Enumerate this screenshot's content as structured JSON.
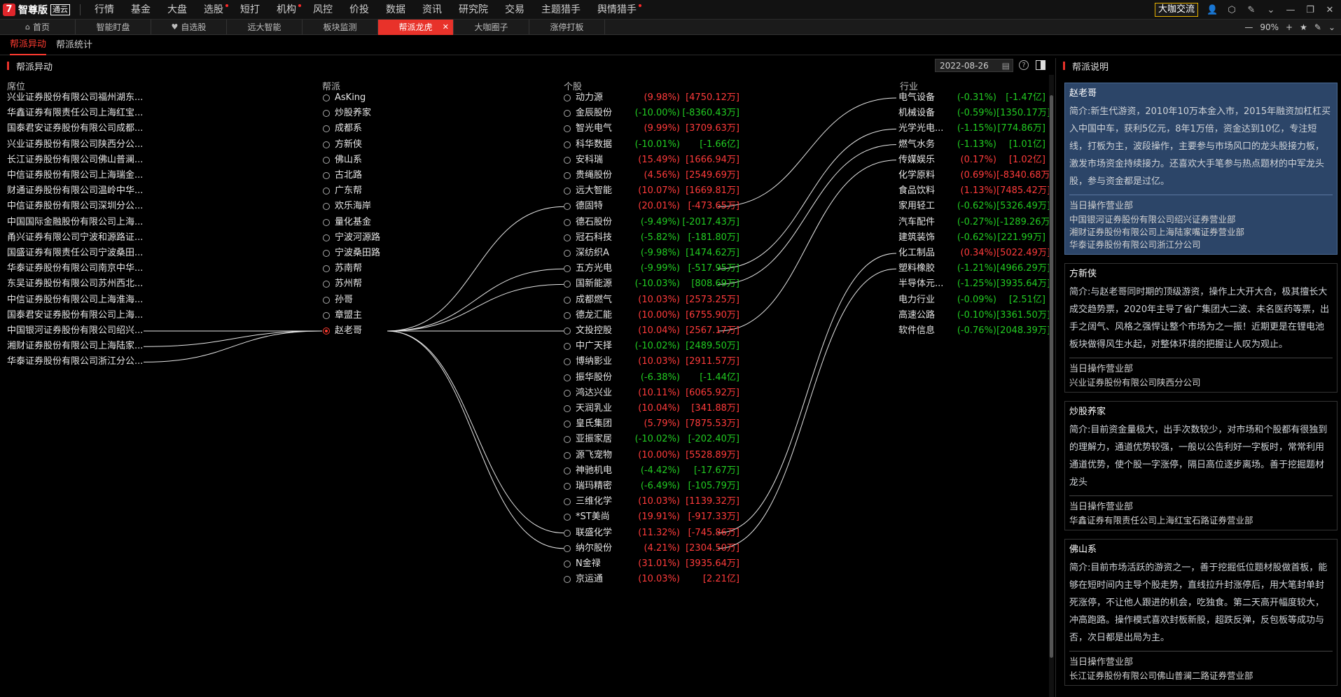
{
  "app": {
    "logo": "智尊版",
    "badge": "通云"
  },
  "menu": [
    {
      "label": "行情",
      "dot": false
    },
    {
      "label": "基金",
      "dot": false
    },
    {
      "label": "大盘",
      "dot": false
    },
    {
      "label": "选股",
      "dot": true
    },
    {
      "label": "短打",
      "dot": false
    },
    {
      "label": "机构",
      "dot": true
    },
    {
      "label": "风控",
      "dot": false
    },
    {
      "label": "价投",
      "dot": false
    },
    {
      "label": "数据",
      "dot": false
    },
    {
      "label": "资讯",
      "dot": false
    },
    {
      "label": "研究院",
      "dot": false
    },
    {
      "label": "交易",
      "dot": false
    },
    {
      "label": "主题猎手",
      "dot": false
    },
    {
      "label": "舆情猎手",
      "dot": true
    }
  ],
  "chat_button": "大咖交流",
  "tabs": [
    {
      "label": "首页",
      "icon": "⌂",
      "active": false
    },
    {
      "label": "智能盯盘",
      "icon": "",
      "active": false
    },
    {
      "label": "自选股",
      "icon": "♥",
      "active": false
    },
    {
      "label": "远大智能",
      "icon": "",
      "active": false
    },
    {
      "label": "板块监测",
      "icon": "",
      "active": false
    },
    {
      "label": "帮派龙虎",
      "icon": "",
      "active": true
    },
    {
      "label": "大咖圈子",
      "icon": "",
      "active": false
    },
    {
      "label": "涨停打板",
      "icon": "",
      "active": false
    }
  ],
  "zoom": "90%",
  "subtabs": [
    {
      "label": "帮派异动",
      "active": true
    },
    {
      "label": "帮派统计",
      "active": false
    }
  ],
  "section_title": "帮派异动",
  "date": "2022-08-26",
  "help_glyph": "?",
  "columns": {
    "seat": "席位",
    "gang": "帮派",
    "stock": "个股",
    "industry": "行业"
  },
  "seats": [
    "兴业证券股份有限公司福州湖东...",
    "华鑫证券有限责任公司上海红宝...",
    "国泰君安证券股份有限公司成都...",
    "兴业证券股份有限公司陕西分公...",
    "长江证券股份有限公司佛山普澜...",
    "中信证券股份有限公司上海瑞金...",
    "财通证券股份有限公司温岭中华...",
    "中信证券股份有限公司深圳分公...",
    "中国国际金融股份有限公司上海...",
    "甬兴证券有限公司宁波和源路证...",
    "国盛证券有限责任公司宁波桑田...",
    "华泰证券股份有限公司南京中华...",
    "东吴证券股份有限公司苏州西北...",
    "中信证券股份有限公司上海淮海...",
    "国泰君安证券股份有限公司上海...",
    "中国银河证券股份有限公司绍兴...",
    "湘财证券股份有限公司上海陆家...",
    "华泰证券股份有限公司浙江分公..."
  ],
  "gangs": [
    {
      "name": "AsKing",
      "selected": false
    },
    {
      "name": "炒股养家",
      "selected": false
    },
    {
      "name": "成都系",
      "selected": false
    },
    {
      "name": "方新侠",
      "selected": false
    },
    {
      "name": "佛山系",
      "selected": false
    },
    {
      "name": "古北路",
      "selected": false
    },
    {
      "name": "广东帮",
      "selected": false
    },
    {
      "name": "欢乐海岸",
      "selected": false
    },
    {
      "name": "量化基金",
      "selected": false
    },
    {
      "name": "宁波河源路",
      "selected": false
    },
    {
      "name": "宁波桑田路",
      "selected": false
    },
    {
      "name": "苏南帮",
      "selected": false
    },
    {
      "name": "苏州帮",
      "selected": false
    },
    {
      "name": "孙哥",
      "selected": false
    },
    {
      "name": "章盟主",
      "selected": false
    },
    {
      "name": "赵老哥",
      "selected": true
    }
  ],
  "stocks": [
    {
      "name": "动力源",
      "pct": "(9.98%)",
      "amt": "[4750.12万]",
      "dir": "up"
    },
    {
      "name": "金辰股份",
      "pct": "(-10.00%)",
      "amt": "[-8360.43万]",
      "dir": "down"
    },
    {
      "name": "智光电气",
      "pct": "(9.99%)",
      "amt": "[3709.63万]",
      "dir": "up"
    },
    {
      "name": "科华数据",
      "pct": "(-10.01%)",
      "amt": "[-1.66亿]",
      "dir": "down"
    },
    {
      "name": "安科瑞",
      "pct": "(15.49%)",
      "amt": "[1666.94万]",
      "dir": "up"
    },
    {
      "name": "贵绳股份",
      "pct": "(4.56%)",
      "amt": "[2549.69万]",
      "dir": "up"
    },
    {
      "name": "远大智能",
      "pct": "(10.07%)",
      "amt": "[1669.81万]",
      "dir": "up"
    },
    {
      "name": "德固特",
      "pct": "(20.01%)",
      "amt": "[-473.65万]",
      "dir": "up"
    },
    {
      "name": "德石股份",
      "pct": "(-9.49%)",
      "amt": "[-2017.43万]",
      "dir": "down"
    },
    {
      "name": "冠石科技",
      "pct": "(-5.82%)",
      "amt": "[-181.80万]",
      "dir": "down"
    },
    {
      "name": "深纺织A",
      "pct": "(-9.98%)",
      "amt": "[1474.62万]",
      "dir": "down"
    },
    {
      "name": "五方光电",
      "pct": "(-9.99%)",
      "amt": "[-517.95万]",
      "dir": "down"
    },
    {
      "name": "国新能源",
      "pct": "(-10.03%)",
      "amt": "[808.69万]",
      "dir": "down"
    },
    {
      "name": "成都燃气",
      "pct": "(10.03%)",
      "amt": "[2573.25万]",
      "dir": "up"
    },
    {
      "name": "德龙汇能",
      "pct": "(10.00%)",
      "amt": "[6755.90万]",
      "dir": "up"
    },
    {
      "name": "文投控股",
      "pct": "(10.04%)",
      "amt": "[2567.17万]",
      "dir": "up"
    },
    {
      "name": "中广天择",
      "pct": "(-10.02%)",
      "amt": "[2489.50万]",
      "dir": "down"
    },
    {
      "name": "博纳影业",
      "pct": "(10.03%)",
      "amt": "[2911.57万]",
      "dir": "up"
    },
    {
      "name": "振华股份",
      "pct": "(-6.38%)",
      "amt": "[-1.44亿]",
      "dir": "down"
    },
    {
      "name": "鸿达兴业",
      "pct": "(10.11%)",
      "amt": "[6065.92万]",
      "dir": "up"
    },
    {
      "name": "天润乳业",
      "pct": "(10.04%)",
      "amt": "[341.88万]",
      "dir": "up"
    },
    {
      "name": "皇氏集团",
      "pct": "(5.79%)",
      "amt": "[7875.53万]",
      "dir": "up"
    },
    {
      "name": "亚振家居",
      "pct": "(-10.02%)",
      "amt": "[-202.40万]",
      "dir": "down"
    },
    {
      "name": "源飞宠物",
      "pct": "(10.00%)",
      "amt": "[5528.89万]",
      "dir": "up"
    },
    {
      "name": "神驰机电",
      "pct": "(-4.42%)",
      "amt": "[-17.67万]",
      "dir": "down"
    },
    {
      "name": "瑞玛精密",
      "pct": "(-6.49%)",
      "amt": "[-105.79万]",
      "dir": "down"
    },
    {
      "name": "三维化学",
      "pct": "(10.03%)",
      "amt": "[1139.32万]",
      "dir": "up"
    },
    {
      "name": "*ST美尚",
      "pct": "(19.91%)",
      "amt": "[-917.33万]",
      "dir": "up"
    },
    {
      "name": "联盛化学",
      "pct": "(11.32%)",
      "amt": "[-745.86万]",
      "dir": "up"
    },
    {
      "name": "纳尔股份",
      "pct": "(4.21%)",
      "amt": "[2304.50万]",
      "dir": "up"
    },
    {
      "name": "N金禄",
      "pct": "(31.01%)",
      "amt": "[3935.64万]",
      "dir": "up"
    },
    {
      "name": "京运通",
      "pct": "(10.03%)",
      "amt": "[2.21亿]",
      "dir": "up"
    }
  ],
  "industries": [
    {
      "name": "电气设备",
      "pct": "(-0.31%)",
      "amt": "[-1.47亿]",
      "dir": "down"
    },
    {
      "name": "机械设备",
      "pct": "(-0.59%)",
      "amt": "[1350.17万]",
      "dir": "down"
    },
    {
      "name": "光学光电...",
      "pct": "(-1.15%)",
      "amt": "[774.86万]",
      "dir": "down"
    },
    {
      "name": "燃气水务",
      "pct": "(-1.13%)",
      "amt": "[1.01亿]",
      "dir": "down"
    },
    {
      "name": "传媒娱乐",
      "pct": "(0.17%)",
      "amt": "[1.02亿]",
      "dir": "up"
    },
    {
      "name": "化学原料",
      "pct": "(0.69%)",
      "amt": "[-8340.68万]",
      "dir": "up"
    },
    {
      "name": "食品饮料",
      "pct": "(1.13%)",
      "amt": "[7485.42万]",
      "dir": "up"
    },
    {
      "name": "家用轻工",
      "pct": "(-0.62%)",
      "amt": "[5326.49万]",
      "dir": "down"
    },
    {
      "name": "汽车配件",
      "pct": "(-0.27%)",
      "amt": "[-1289.26万]",
      "dir": "down"
    },
    {
      "name": "建筑装饰",
      "pct": "(-0.62%)",
      "amt": "[221.99万]",
      "dir": "down"
    },
    {
      "name": "化工制品",
      "pct": "(0.34%)",
      "amt": "[5022.49万]",
      "dir": "up"
    },
    {
      "name": "塑料橡胶",
      "pct": "(-1.21%)",
      "amt": "[4966.29万]",
      "dir": "down"
    },
    {
      "name": "半导体元...",
      "pct": "(-1.25%)",
      "amt": "[3935.64万]",
      "dir": "down"
    },
    {
      "name": "电力行业",
      "pct": "(-0.09%)",
      "amt": "[2.51亿]",
      "dir": "down"
    },
    {
      "name": "高速公路",
      "pct": "(-0.10%)",
      "amt": "[3361.50万]",
      "dir": "down"
    },
    {
      "name": "软件信息",
      "pct": "(-0.76%)",
      "amt": "[2048.39万]",
      "dir": "down"
    }
  ],
  "links": {
    "seat_to_gang": [
      15,
      16,
      17
    ],
    "gang_index": 15,
    "gang_to_stock": [
      7,
      11,
      12,
      15,
      28,
      29
    ],
    "stock_to_industry": [
      [
        7,
        0
      ],
      [
        11,
        2
      ],
      [
        12,
        3
      ],
      [
        15,
        4
      ],
      [
        28,
        10
      ],
      [
        29,
        11
      ]
    ]
  },
  "right_panel": {
    "title": "帮派说明",
    "cards": [
      {
        "title": "赵老哥",
        "active": true,
        "desc": "简介:新生代游资，2010年10万本金入市，2015年融资加杠杠买入中国中车，获利5亿元，8年1万倍，资金达到10亿，专注短线，打板为主，波段操作，主要参与市场风口的龙头股接力板，激发市场资金持续接力。还喜欢大手笔参与热点题材的中军龙头股，参与资金都是过亿。",
        "sub": "当日操作营业部",
        "branches": [
          "中国银河证券股份有限公司绍兴证券营业部",
          "湘财证券股份有限公司上海陆家嘴证券营业部",
          "华泰证券股份有限公司浙江分公司"
        ]
      },
      {
        "title": "方新侠",
        "active": false,
        "desc": "简介:与赵老哥同时期的顶级游资，操作上大开大合，极其擅长大成交趋势票，2020年主导了省广集团大二波、未名医药等票，出手之阔气、风格之强悍让整个市场为之一振！近期更是在锂电池板块做得风生水起，对整体环境的把握让人叹为观止。",
        "sub": "当日操作营业部",
        "branches": [
          "兴业证券股份有限公司陕西分公司"
        ]
      },
      {
        "title": "炒股养家",
        "active": false,
        "desc": "简介:目前资金量极大，出手次数较少，对市场和个股都有很独到的理解力，通道优势较强，一般以公告利好一字板时，常常利用通道优势，使个股一字涨停，隔日高位逐步离场。善于挖掘题材龙头",
        "sub": "当日操作营业部",
        "branches": [
          "华鑫证券有限责任公司上海红宝石路证券营业部"
        ]
      },
      {
        "title": "佛山系",
        "active": false,
        "desc": "简介:目前市场活跃的游资之一，善于挖掘低位题材股做首板，能够在短时间内主导个股走势，直线拉升封涨停后，用大笔封单封死涨停，不让他人跟进的机会，吃独食。第二天高开幅度较大，冲高跑路。操作模式喜欢封板新股，超跌反弹，反包板等成功与否，次日都是出局为主。",
        "sub": "当日操作营业部",
        "branches": [
          "长江证券股份有限公司佛山普澜二路证券营业部"
        ]
      }
    ]
  }
}
